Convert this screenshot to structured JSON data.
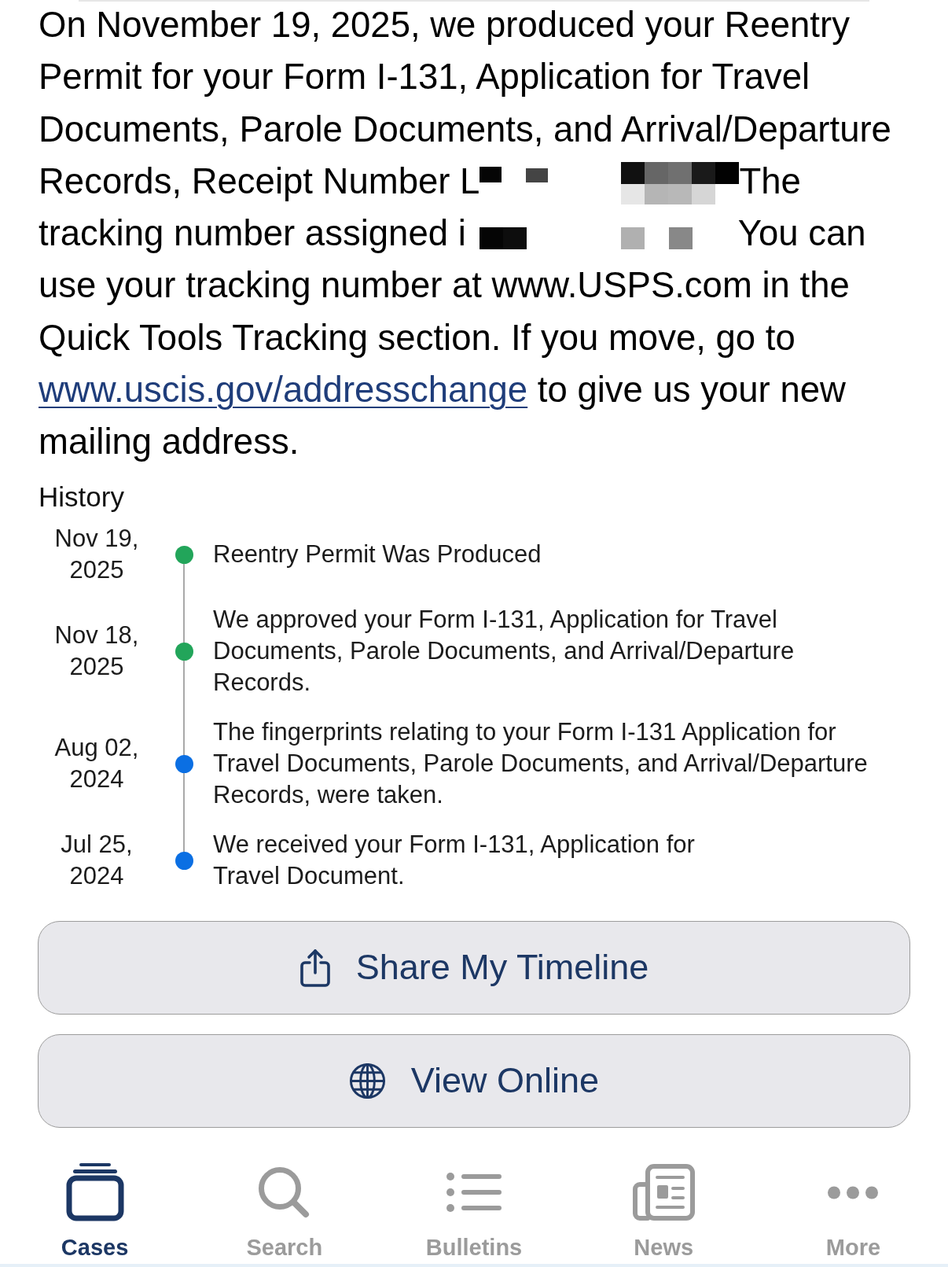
{
  "message": {
    "segments": [
      {
        "kind": "text",
        "text": "On November 19, 2025, we produced your Reentry Permit for your Form I-131, Application for Travel Documents, Parole Documents, and Arrival/Departure Records, Receipt Number L"
      },
      {
        "kind": "redacted"
      },
      {
        "kind": "text",
        "text": "The tracking number assigned i"
      },
      {
        "kind": "redacted"
      },
      {
        "kind": "text",
        "text": "You can use your tracking number at www.USPS.com in the Quick Tools Tracking section. If you move, go to"
      },
      {
        "kind": "link",
        "text": "www.uscis.gov/addresschange"
      },
      {
        "kind": "text",
        "text": "to give us your new mailing address."
      }
    ]
  },
  "history": {
    "title": "History",
    "events": [
      {
        "date": "Nov 19, 2025",
        "text": "Reentry Permit Was Produced",
        "color": "#22a55a"
      },
      {
        "date": "Nov 18, 2025",
        "text": "We approved your Form I-131, Application for Travel Documents, Parole Documents, and Arrival/Departure Records.",
        "color": "#22a55a"
      },
      {
        "date": "Aug 02, 2024",
        "text": "The fingerprints relating to your Form I-131 Application for Travel Documents, Parole Documents, and Arrival/Departure Records, were taken.",
        "color": "#0b6fe3"
      },
      {
        "date": "Jul 25, 2024",
        "text": "We received your Form I-131, Application for\nTravel Document.",
        "color": "#0b6fe3"
      }
    ]
  },
  "actions": [
    {
      "kind": "share",
      "label": "Share My Timeline"
    },
    {
      "kind": "globe",
      "label": "View Online"
    }
  ],
  "tabs": [
    {
      "kind": "cases",
      "label": "Cases",
      "selected": true
    },
    {
      "kind": "search",
      "label": "Search",
      "selected": false
    },
    {
      "kind": "bulletins",
      "label": "Bulletins",
      "selected": false
    },
    {
      "kind": "news",
      "label": "News",
      "selected": false
    },
    {
      "kind": "more",
      "label": "More",
      "selected": false
    }
  ]
}
